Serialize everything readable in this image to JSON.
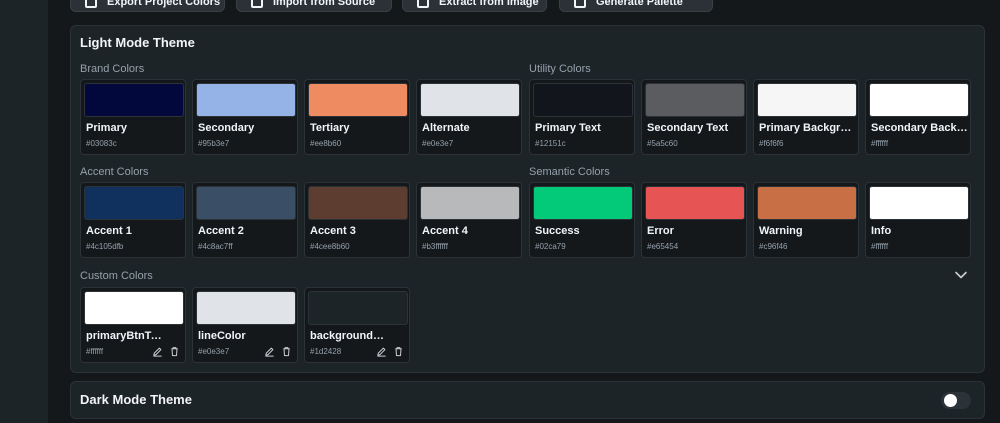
{
  "toolbar": {
    "buttons": [
      {
        "label": "Export Project Colors",
        "icon": "export-icon"
      },
      {
        "label": "Import from Source",
        "icon": "import-icon"
      },
      {
        "label": "Extract from Image",
        "icon": "image-icon"
      },
      {
        "label": "Generate Palette",
        "icon": "wand-icon"
      }
    ]
  },
  "light_theme": {
    "title": "Light Mode Theme",
    "brand": {
      "label": "Brand Colors",
      "items": [
        {
          "name": "Primary",
          "hex": "#03083c",
          "color": "#03083c"
        },
        {
          "name": "Secondary",
          "hex": "#95b3e7",
          "color": "#95b3e7"
        },
        {
          "name": "Tertiary",
          "hex": "#ee8b60",
          "color": "#ee8b60"
        },
        {
          "name": "Alternate",
          "hex": "#e0e3e7",
          "color": "#e0e3e7"
        }
      ]
    },
    "utility": {
      "label": "Utility Colors",
      "items": [
        {
          "name": "Primary Text",
          "hex": "#12151c",
          "color": "#12151c"
        },
        {
          "name": "Secondary Text",
          "hex": "#5a5c60",
          "color": "#5a5c60"
        },
        {
          "name": "Primary Background",
          "hex": "#f6f6f6",
          "color": "#f6f6f6"
        },
        {
          "name": "Secondary Background",
          "hex": "#ffffff",
          "color": "#ffffff"
        }
      ]
    },
    "accent": {
      "label": "Accent Colors",
      "items": [
        {
          "name": "Accent 1",
          "hex": "#4c105dfb",
          "color": "#10305d"
        },
        {
          "name": "Accent 2",
          "hex": "#4c8ac7ff",
          "color": "#3a4f66"
        },
        {
          "name": "Accent 3",
          "hex": "#4cee8b60",
          "color": "#5c3d30"
        },
        {
          "name": "Accent 4",
          "hex": "#b3ffffff",
          "color": "#b8b9bb"
        }
      ]
    },
    "semantic": {
      "label": "Semantic Colors",
      "items": [
        {
          "name": "Success",
          "hex": "#02ca79",
          "color": "#02ca79"
        },
        {
          "name": "Error",
          "hex": "#e65454",
          "color": "#e65454"
        },
        {
          "name": "Warning",
          "hex": "#c96f46",
          "color": "#c96f46"
        },
        {
          "name": "Info",
          "hex": "#ffffff",
          "color": "#ffffff"
        }
      ]
    },
    "custom": {
      "label": "Custom Colors",
      "items": [
        {
          "name": "primaryBtnText",
          "hex": "#ffffff",
          "color": "#ffffff"
        },
        {
          "name": "lineColor",
          "hex": "#e0e3e7",
          "color": "#e0e3e7"
        },
        {
          "name": "backgroundComponents",
          "hex": "#1d2428",
          "color": "#1d2428"
        }
      ]
    }
  },
  "dark_theme": {
    "title": "Dark Mode Theme",
    "toggle_on": false
  }
}
